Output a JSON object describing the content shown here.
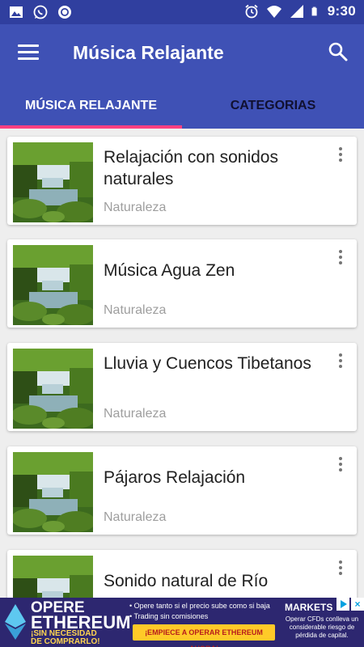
{
  "status_bar": {
    "time": "9:30",
    "left_icons": [
      "image-icon",
      "whatsapp-icon",
      "circle-notification-icon"
    ],
    "right_icons": [
      "alarm-icon",
      "wifi-icon",
      "signal-icon",
      "battery-icon"
    ]
  },
  "app_bar": {
    "title": "Música Relajante",
    "menu_icon": "hamburger-menu-icon",
    "search_icon": "search-icon"
  },
  "tabs": [
    {
      "label": "MÚSICA RELAJANTE",
      "selected": true
    },
    {
      "label": "CATEGORIAS",
      "selected": false
    }
  ],
  "items": [
    {
      "title": "Relajación con sonidos naturales",
      "category": "Naturaleza"
    },
    {
      "title": "Música Agua Zen",
      "category": "Naturaleza"
    },
    {
      "title": "Lluvia y Cuencos Tibetanos",
      "category": "Naturaleza"
    },
    {
      "title": "Pájaros Relajación",
      "category": "Naturaleza"
    },
    {
      "title": "Sonido natural de Río",
      "category": ""
    }
  ],
  "ad": {
    "headline_1": "OPERE",
    "headline_2": "ETHEREUM",
    "headline_3a": "¡SIN NECESIDAD",
    "headline_3b": "DE COMPRARLO!",
    "bullet_1": "• Opere tanto si el precio sube como si baja",
    "bullet_2": "• Trading sin comisiones",
    "cta": "¡EMPIECE A OPERAR ETHEREUM AHORA!",
    "brand": "MARKETS",
    "disclaimer": "Operar CFDs conlleva un considerable riesgo de pérdida de capital."
  },
  "colors": {
    "status_bar": "#303f9f",
    "primary": "#3f51b5",
    "accent": "#ff4081",
    "background": "#eeeeee"
  }
}
